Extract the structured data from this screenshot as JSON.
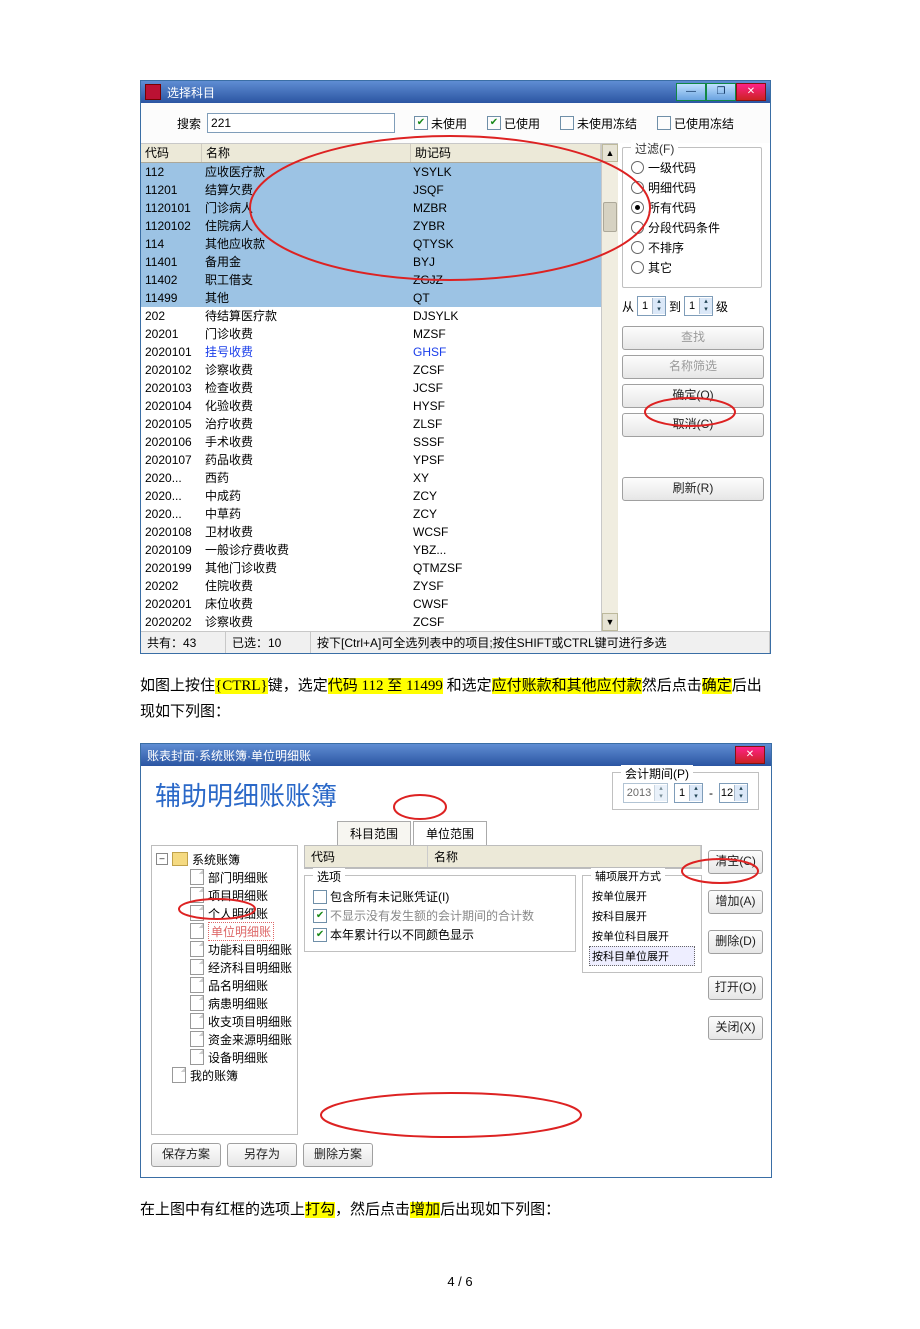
{
  "win1": {
    "title": "选择科目",
    "search_label": "搜索",
    "search_value": "221",
    "chk_unused": "未使用",
    "chk_used": "已使用",
    "chk_unused_frozen": "未使用冻结",
    "chk_used_frozen": "已使用冻结",
    "headers": {
      "code": "代码",
      "name": "名称",
      "mnem": "助记码"
    },
    "rows": [
      {
        "code": "112",
        "name": "应收医疗款",
        "mnem": "YSYLK",
        "sel": true
      },
      {
        "code": "11201",
        "name": "结算欠费",
        "mnem": "JSQF",
        "sel": true
      },
      {
        "code": "1120101",
        "name": "门诊病人",
        "mnem": "MZBR",
        "sel": true
      },
      {
        "code": "1120102",
        "name": "住院病人",
        "mnem": "ZYBR",
        "sel": true
      },
      {
        "code": "114",
        "name": "其他应收款",
        "mnem": "QTYSK",
        "sel": true
      },
      {
        "code": "11401",
        "name": "备用金",
        "mnem": "BYJ",
        "sel": true
      },
      {
        "code": "11402",
        "name": "职工借支",
        "mnem": "ZGJZ",
        "sel": true
      },
      {
        "code": "11499",
        "name": "其他",
        "mnem": "QT",
        "sel": true
      },
      {
        "code": "202",
        "name": "待结算医疗款",
        "mnem": "DJSYLK"
      },
      {
        "code": "20201",
        "name": "门诊收费",
        "mnem": "MZSF"
      },
      {
        "code": "2020101",
        "name": "挂号收费",
        "mnem": "GHSF",
        "link": true
      },
      {
        "code": "2020102",
        "name": "诊察收费",
        "mnem": "ZCSF"
      },
      {
        "code": "2020103",
        "name": "检查收费",
        "mnem": "JCSF"
      },
      {
        "code": "2020104",
        "name": "化验收费",
        "mnem": "HYSF"
      },
      {
        "code": "2020105",
        "name": "治疗收费",
        "mnem": "ZLSF"
      },
      {
        "code": "2020106",
        "name": "手术收费",
        "mnem": "SSSF"
      },
      {
        "code": "2020107",
        "name": "药品收费",
        "mnem": "YPSF"
      },
      {
        "code": "2020...",
        "name": "西药",
        "mnem": "XY"
      },
      {
        "code": "2020...",
        "name": "中成药",
        "mnem": "ZCY"
      },
      {
        "code": "2020...",
        "name": "中草药",
        "mnem": "ZCY"
      },
      {
        "code": "2020108",
        "name": "卫材收费",
        "mnem": "WCSF"
      },
      {
        "code": "2020109",
        "name": "一般诊疗费收费",
        "mnem": "YBZ..."
      },
      {
        "code": "2020199",
        "name": "其他门诊收费",
        "mnem": "QTMZSF"
      },
      {
        "code": "20202",
        "name": "住院收费",
        "mnem": "ZYSF"
      },
      {
        "code": "2020201",
        "name": "床位收费",
        "mnem": "CWSF"
      },
      {
        "code": "2020202",
        "name": "诊察收费",
        "mnem": "ZCSF"
      }
    ],
    "filter": {
      "legend": "过滤(F)",
      "opts": [
        "一级代码",
        "明细代码",
        "所有代码",
        "分段代码条件",
        "不排序",
        "其它"
      ],
      "from_label": "从",
      "to_label": "到",
      "level_label": "级",
      "from": "1",
      "to": "1"
    },
    "btn_find": "查找",
    "btn_namefilter": "名称筛选",
    "btn_ok": "确定(O)",
    "btn_cancel": "取消(C)",
    "btn_refresh": "刷新(R)",
    "status_total": "共有：43",
    "status_sel": "已选：10",
    "status_hint": "按下[Ctrl+A]可全选列表中的项目;按住SHIFT或CTRL键可进行多选"
  },
  "para1": {
    "t0": "如图上按住",
    "hl1": "{CTRL}",
    "t1": "键，选定",
    "hl2": "代码 112 至 11499",
    "t2": " 和选定",
    "hl3": "应付账款和其他应付款",
    "t3": "然后点击",
    "hl4": "确定",
    "t4": "后出现如下列图："
  },
  "win2": {
    "title": "账表封面·系统账簿·单位明细账",
    "heading": "辅助明细账账簿",
    "period_legend": "会计期间(P)",
    "year": "2013",
    "m1": "1",
    "m2": "12",
    "tab_subject": "科目范围",
    "tab_unit": "单位范围",
    "grid_code": "代码",
    "grid_name": "名称",
    "btn_clear": "清空(C)",
    "btn_add": "增加(A)",
    "btn_del": "删除(D)",
    "tree_root": "系统账簿",
    "tree_items": [
      "部门明细账",
      "项目明细账",
      "个人明细账",
      "单位明细账",
      "功能科目明细账",
      "经济科目明细账",
      "品名明细账",
      "病患明细账",
      "收支项目明细账",
      "资金来源明细账",
      "设备明细账"
    ],
    "tree_my": "我的账簿",
    "opt_legend": "选项",
    "opt1": "包含所有未记账凭证(I)",
    "opt2": "不显示没有发生额的会计期间的合计数",
    "opt3": "本年累计行以不同颜色显示",
    "aux_legend": "辅项展开方式",
    "aux_items": [
      "按单位展开",
      "按科目展开",
      "按单位科目展开",
      "按科目单位展开"
    ],
    "btn_open": "打开(O)",
    "btn_close": "关闭(X)",
    "btn_save": "保存方案",
    "btn_saveas": "另存为",
    "btn_delplan": "删除方案"
  },
  "para2": {
    "t0": "在上图中有红框的选项上",
    "hl1": "打勾",
    "t1": "，然后点击",
    "hl2": "增加",
    "t2": "后出现如下列图："
  },
  "page_no": "4 / 6"
}
